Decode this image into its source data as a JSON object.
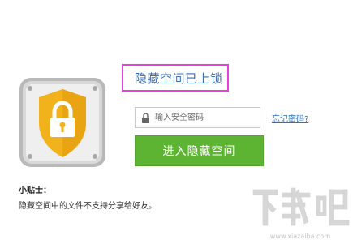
{
  "title": "隐藏空间已上锁",
  "password": {
    "placeholder": "输入安全密码",
    "value": ""
  },
  "forgot_link": "忘记密码?",
  "enter_button": "进入隐藏空间",
  "tips": {
    "title": "小贴士：",
    "text": "隐藏空间中的文件不支持分享给好友。"
  },
  "watermark": {
    "text": "下载吧",
    "url": "www.xiazaiba.com"
  },
  "icons": {
    "safe": "safe-lock-icon",
    "lock": "lock-icon"
  },
  "colors": {
    "accent_green": "#5db432",
    "title_blue": "#3b6eb5",
    "link_blue": "#2e6fc0",
    "highlight": "#e83ee0",
    "shield_gold": "#f2b21c"
  }
}
